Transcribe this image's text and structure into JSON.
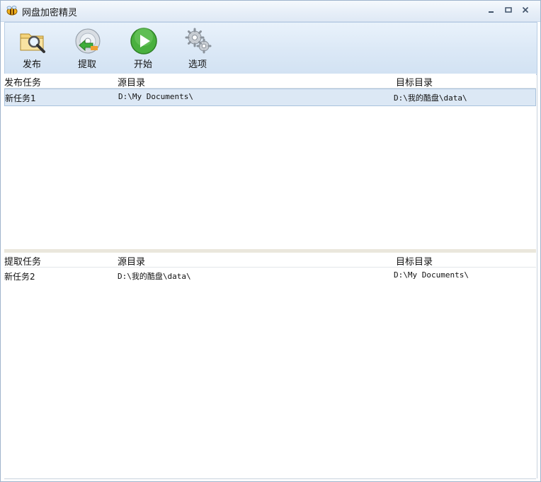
{
  "window": {
    "title": "网盘加密精灵"
  },
  "toolbar": {
    "publish_label": "发布",
    "extract_label": "提取",
    "start_label": "开始",
    "options_label": "选项"
  },
  "publish_list": {
    "columns": [
      "发布任务",
      "源目录",
      "目标目录"
    ],
    "rows": [
      {
        "task": "新任务1",
        "source": "D:\\My Documents\\",
        "target": "D:\\我的酷盘\\data\\"
      }
    ]
  },
  "extract_list": {
    "columns": [
      "提取任务",
      "源目录",
      "目标目录"
    ],
    "rows": [
      {
        "task": "新任务2",
        "source": "D:\\我的酷盘\\data\\",
        "target": "D:\\My Documents\\"
      }
    ]
  },
  "icons": {
    "app": "bee-icon",
    "publish": "folder-search-icon",
    "extract": "disc-arrow-icon",
    "start": "play-icon",
    "options": "gears-icon",
    "minimize": "minimize-icon",
    "maximize": "maximize-icon",
    "close": "close-icon"
  }
}
